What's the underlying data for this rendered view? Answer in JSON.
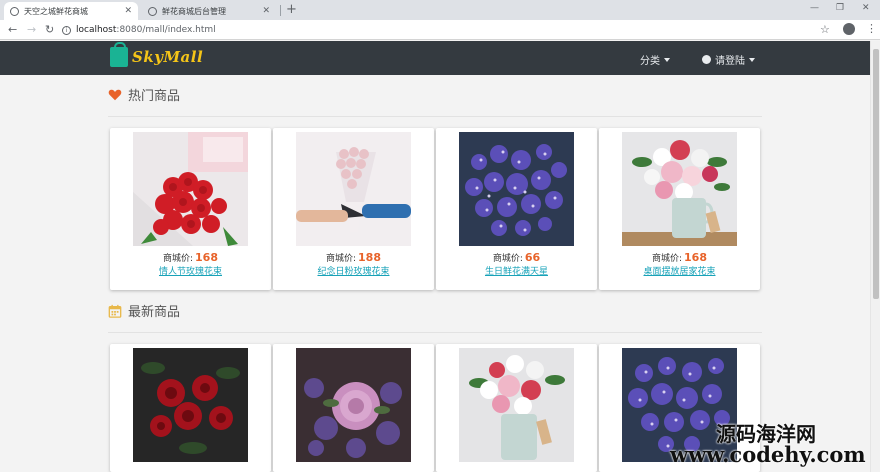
{
  "browser": {
    "tabs": [
      {
        "title": "天空之城鲜花商城",
        "active": true
      },
      {
        "title": "鲜花商城后台管理",
        "active": false
      }
    ],
    "url_host": "localhost",
    "url_path": ":8080/mall/index.html"
  },
  "navbar": {
    "logo_text": "SkyMall",
    "category_label": "分类",
    "login_label": "请登陆"
  },
  "hot": {
    "title": "热门商品",
    "items": [
      {
        "price_label": "商城价:",
        "price": "168",
        "name": "情人节玫瑰花束"
      },
      {
        "price_label": "商城价:",
        "price": "188",
        "name": "纪念日粉玫瑰花束"
      },
      {
        "price_label": "商城价:",
        "price": "66",
        "name": "生日鲜花满天星"
      },
      {
        "price_label": "商城价:",
        "price": "168",
        "name": "桌面摆放居家花束"
      }
    ]
  },
  "latest": {
    "title": "最新商品"
  },
  "watermark": {
    "line1": "源码海洋网",
    "line2": "www.codehy.com"
  },
  "colors": {
    "navbar_bg": "#343a40",
    "price": "#e8632a",
    "link": "#17a2b8",
    "heart": "#e8632a",
    "calendar": "#e8b84a"
  }
}
